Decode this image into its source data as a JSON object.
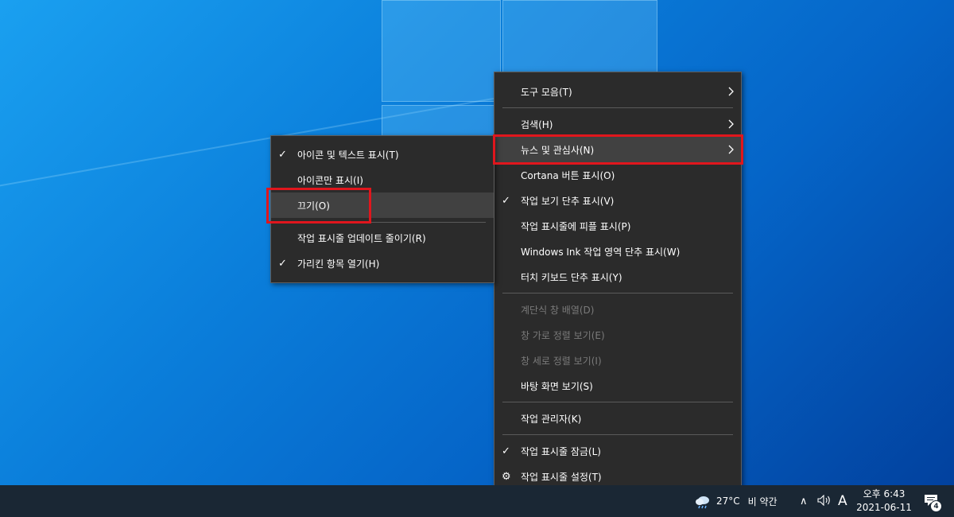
{
  "main_menu": {
    "items": [
      {
        "label": "도구 모음(T)",
        "check": "",
        "submenu": true,
        "disabled": false
      },
      {
        "label": "검색(H)",
        "check": "",
        "submenu": true,
        "disabled": false
      },
      {
        "label": "뉴스 및 관심사(N)",
        "check": "",
        "submenu": true,
        "disabled": false
      },
      {
        "label": "Cortana 버튼 표시(O)",
        "check": "",
        "submenu": false,
        "disabled": false
      },
      {
        "label": "작업 보기 단추 표시(V)",
        "check": "✓",
        "submenu": false,
        "disabled": false
      },
      {
        "label": "작업 표시줄에 피플 표시(P)",
        "check": "",
        "submenu": false,
        "disabled": false
      },
      {
        "label": "Windows Ink 작업 영역 단추 표시(W)",
        "check": "",
        "submenu": false,
        "disabled": false
      },
      {
        "label": "터치 키보드 단추 표시(Y)",
        "check": "",
        "submenu": false,
        "disabled": false
      },
      {
        "label": "계단식 창 배열(D)",
        "check": "",
        "submenu": false,
        "disabled": true
      },
      {
        "label": "창 가로 정렬 보기(E)",
        "check": "",
        "submenu": false,
        "disabled": true
      },
      {
        "label": "창 세로 정렬 보기(I)",
        "check": "",
        "submenu": false,
        "disabled": true
      },
      {
        "label": "바탕 화면 보기(S)",
        "check": "",
        "submenu": false,
        "disabled": false
      },
      {
        "label": "작업 관리자(K)",
        "check": "",
        "submenu": false,
        "disabled": false
      },
      {
        "label": "작업 표시줄 잠금(L)",
        "check": "✓",
        "submenu": false,
        "disabled": false
      },
      {
        "label": "작업 표시줄 설정(T)",
        "check": "⚙",
        "submenu": false,
        "disabled": false
      }
    ]
  },
  "sub_menu": {
    "items": [
      {
        "label": "아이콘 및 텍스트 표시(T)",
        "check": "✓"
      },
      {
        "label": "아이콘만 표시(I)",
        "check": ""
      },
      {
        "label": "끄기(O)",
        "check": ""
      },
      {
        "label": "작업 표시줄 업데이트 줄이기(R)",
        "check": ""
      },
      {
        "label": "가리킨 항목 열기(H)",
        "check": "✓"
      }
    ]
  },
  "taskbar": {
    "weather_temp": "27°C",
    "weather_text": "비 약간",
    "chevron": "∧",
    "ime": "A",
    "time": "오후 6:43",
    "date": "2021-06-11",
    "notification_count": "4"
  },
  "colors": {
    "highlight_border": "#e0161d",
    "menu_bg": "#2b2b2b",
    "taskbar_bg": "#1a2734"
  }
}
